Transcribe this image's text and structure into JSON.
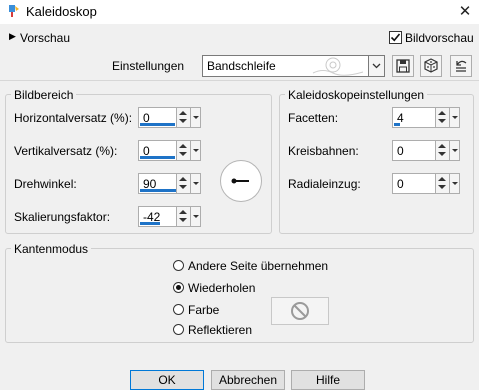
{
  "window": {
    "title": "Kaleidoskop",
    "close_glyph": "✕",
    "icon": "paint-brush-icon"
  },
  "preview_toggle": {
    "label": "Vorschau",
    "arrow": "▶"
  },
  "bildvorschau": {
    "label": "Bildvorschau",
    "checked": true
  },
  "settings": {
    "label": "Einstellungen",
    "selected": "Bandschleife",
    "tools": [
      "save-icon",
      "dice-icon",
      "reset-icon"
    ]
  },
  "bildbereich": {
    "legend": "Bildbereich",
    "fields": [
      {
        "label": "Horizontalversatz (%):",
        "value": "0",
        "level": 0.5
      },
      {
        "label": "Vertikalversatz (%):",
        "value": "0",
        "level": 0.5
      },
      {
        "label": "Drehwinkel:",
        "value": "90",
        "level": 0.7
      },
      {
        "label": "Skalierungsfaktor:",
        "value": "-42",
        "level": 0.35
      }
    ]
  },
  "kaleido": {
    "legend": "Kaleidoskopeinstellungen",
    "fields": [
      {
        "label": "Facetten:",
        "value": "4",
        "level": 0.1
      },
      {
        "label": "Kreisbahnen:",
        "value": "0",
        "level": 0
      },
      {
        "label": "Radialeinzug:",
        "value": "0",
        "level": 0
      }
    ]
  },
  "kantenmodus": {
    "legend": "Kantenmodus",
    "options": [
      {
        "label": "Andere Seite übernehmen",
        "selected": false
      },
      {
        "label": "Wiederholen",
        "selected": true
      },
      {
        "label": "Farbe",
        "selected": false
      },
      {
        "label": "Reflektieren",
        "selected": false
      }
    ],
    "color_swatch_icon": "no-symbol-icon"
  },
  "buttons": {
    "ok": "OK",
    "cancel": "Abbrechen",
    "help": "Hilfe"
  },
  "colors": {
    "accent": "#1e73c7",
    "focus": "#0078d7"
  }
}
